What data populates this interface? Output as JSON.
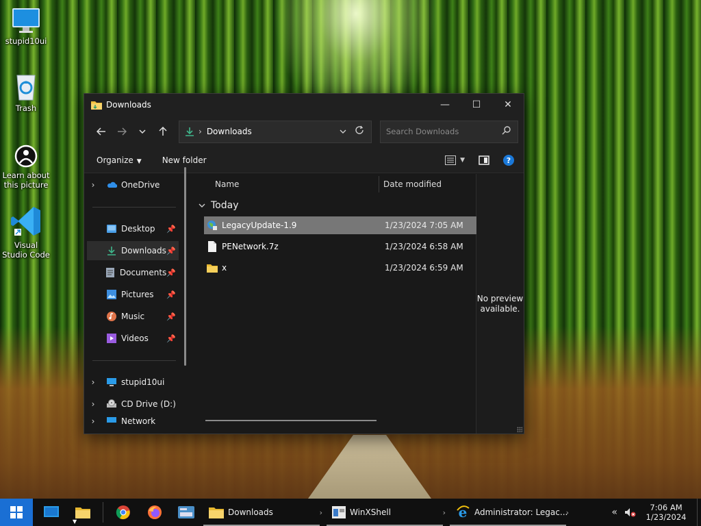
{
  "desktop": {
    "icons": [
      {
        "label": "stupid10ui",
        "icon": "computer-icon"
      },
      {
        "label": "Trash",
        "icon": "recycle-bin-icon"
      },
      {
        "label": "Learn about this picture",
        "icon": "learn-about-picture-icon"
      },
      {
        "label": "Visual Studio Code",
        "icon": "vscode-icon"
      }
    ]
  },
  "window": {
    "title": "Downloads",
    "controls": {
      "minimize": "—",
      "maximize": "☐",
      "close": "✕"
    },
    "address": {
      "segment": "Downloads"
    },
    "search": {
      "placeholder": "Search Downloads"
    },
    "commands": {
      "organize": "Organize",
      "new_folder": "New folder"
    },
    "nav": {
      "onedrive": "OneDrive",
      "quick_access": [
        {
          "label": "Desktop",
          "icon": "desktop-folder-icon",
          "color": "#4a9fe8"
        },
        {
          "label": "Downloads",
          "icon": "download-icon",
          "color": "#3fb68b"
        },
        {
          "label": "Documents",
          "icon": "documents-icon",
          "color": "#9aa7b8"
        },
        {
          "label": "Pictures",
          "icon": "pictures-icon",
          "color": "#3c8ee0"
        },
        {
          "label": "Music",
          "icon": "music-icon",
          "color": "#e0744a"
        },
        {
          "label": "Videos",
          "icon": "videos-icon",
          "color": "#9a5ce0"
        }
      ],
      "this_pc": "stupid10ui",
      "cd_drive": "CD Drive (D:)",
      "network": "Network"
    },
    "columns": {
      "name": "Name",
      "date_modified": "Date modified"
    },
    "group": "Today",
    "files": [
      {
        "name": "LegacyUpdate-1.9",
        "date": "1/23/2024 7:05 AM",
        "icon": "installer-globe-icon"
      },
      {
        "name": "PENetwork.7z",
        "date": "1/23/2024 6:58 AM",
        "icon": "file-icon"
      },
      {
        "name": "x",
        "date": "1/23/2024 6:59 AM",
        "icon": "folder-icon"
      }
    ],
    "preview": {
      "text_line1": "No preview",
      "text_line2": "available."
    }
  },
  "taskbar": {
    "tasks": [
      {
        "label": "Downloads",
        "icon": "file-explorer-icon"
      },
      {
        "label": "WinXShell",
        "icon": "winxshell-icon"
      },
      {
        "label": "Administrator: Legac...",
        "icon": "internet-explorer-icon"
      }
    ],
    "clock": {
      "time": "7:06 AM",
      "date": "1/23/2024"
    }
  },
  "colors": {
    "accent": "#1a6fd4",
    "selection": "#777777",
    "window_bg": "#191919"
  }
}
